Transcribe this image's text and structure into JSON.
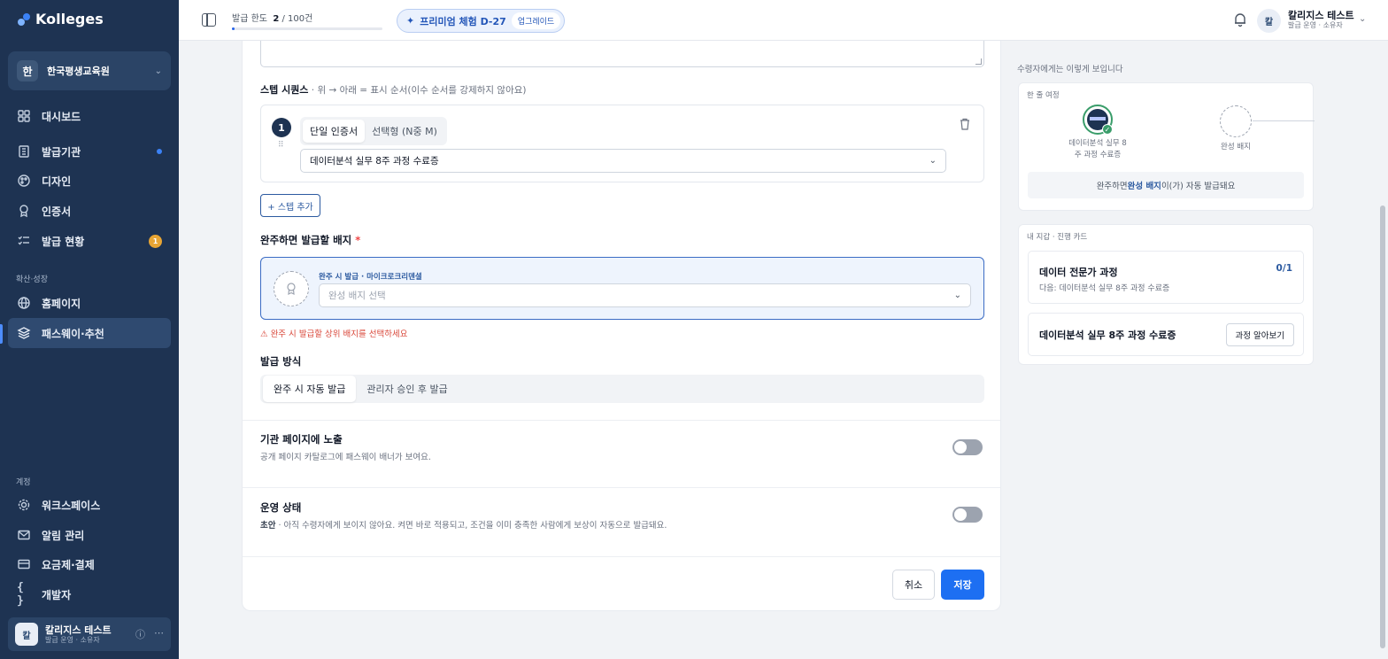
{
  "app": {
    "name": "Kolleges"
  },
  "sidebar": {
    "org": {
      "avatar": "한",
      "name": "한국평생교육원"
    },
    "items": [
      {
        "label": "대시보드",
        "icon": "dashboard-icon"
      },
      {
        "label": "발급기관",
        "icon": "building-icon"
      },
      {
        "label": "디자인",
        "icon": "palette-icon"
      },
      {
        "label": "인증서",
        "icon": "award-icon"
      },
      {
        "label": "발급 현황",
        "icon": "list-check-icon",
        "badge": "1"
      }
    ],
    "growth_label": "확산·성장",
    "growth_items": [
      {
        "label": "홈페이지",
        "icon": "globe-icon"
      },
      {
        "label": "패스웨이·추천",
        "icon": "layers-icon"
      }
    ],
    "account_label": "계정",
    "account_items": [
      {
        "label": "워크스페이스",
        "icon": "gear-icon"
      },
      {
        "label": "알림 관리",
        "icon": "mail-icon"
      },
      {
        "label": "요금제·결제",
        "icon": "card-icon"
      },
      {
        "label": "개발자",
        "icon": "braces-icon"
      }
    ],
    "user": {
      "avatar": "칼",
      "name": "칼리지스 테스트",
      "role": "발급 운영 · 소유자"
    }
  },
  "topbar": {
    "quota_label": "발급 한도",
    "quota_used": "2",
    "quota_total": "/ 100건",
    "quota_fraction": 0.02,
    "premium_label": "프리미엄 체험 D-27",
    "upgrade_label": "업그레이드",
    "user_avatar": "칼",
    "user_name": "칼리지스 테스트",
    "user_role": "발급 운영 · 소유자"
  },
  "form": {
    "step_title": "스텝 시퀀스",
    "step_hint": " · 위 → 아래 = 표시 순서(이수 순서를 강제하지 않아요)",
    "step": {
      "number": "1",
      "mode_single": "단일 인증서",
      "mode_choice": "선택형 (N중 M)",
      "selected": "데이터분석 실무 8주 과정 수료증"
    },
    "add_step": "+ 스텝 추가",
    "badge_label": "완주하면 발급할 배지",
    "badge_required": "*",
    "badge_hint": "완주 시 발급 · 마이크로크리덴셜",
    "badge_placeholder": "완성 배지 선택",
    "badge_error": "완주 시 발급할 상위 배지를 선택하세요",
    "issue_label": "발급 방식",
    "issue_auto": "완주 시 자동 발급",
    "issue_manual": "관리자 승인 후 발급",
    "expose_title": "기관 페이지에 노출",
    "expose_desc": "공개 페이지 카탈로그에 패스웨이 배너가 보여요.",
    "expose_on": false,
    "status_title": "운영 상태",
    "status_strong": "초안",
    "status_desc": " · 아직 수령자에게 보이지 않아요. 켜면 바로 적용되고, 조건을 이미 충족한 사람에게 보상이 자동으로 발급돼요.",
    "status_on": false,
    "cancel": "취소",
    "save": "저장"
  },
  "preview": {
    "title": "수령자에게는 이렇게 보입니다",
    "journey_label": "한 줄 여정",
    "node1_label": "데이터분석 실무 8\n주 과정 수료증",
    "node2_label": "완성 배지",
    "auto_pre": "완주하면 ",
    "auto_badge": "완성 배지",
    "auto_post": "이(가) 자동 발급돼요",
    "wallet_label": "내 지갑 · 진행 카드",
    "card_title": "데이터 전문가 과정",
    "card_count": "0/1",
    "card_next": "다음: 데이터분석 실무 8주 과정 수료증",
    "course_title": "데이터분석 실무 8주 과정 수료증",
    "course_btn": "과정 알아보기"
  }
}
